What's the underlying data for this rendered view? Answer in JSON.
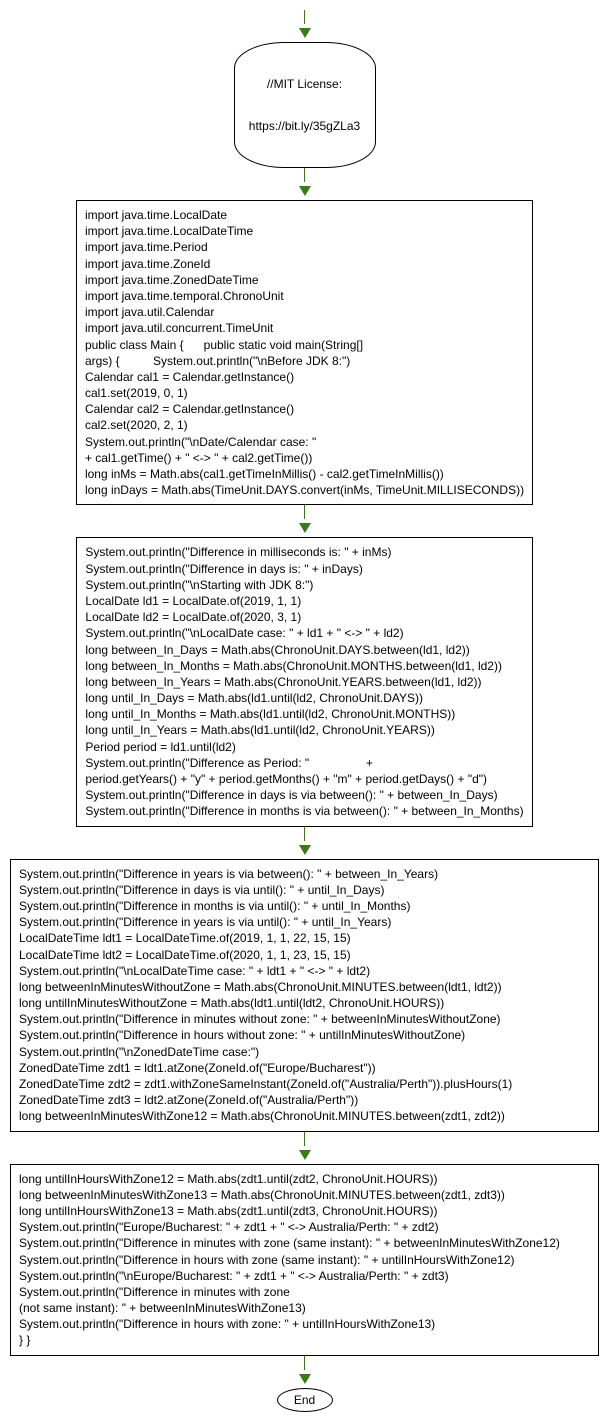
{
  "start": {
    "line1": "//MIT License:",
    "line2": "https://bit.ly/35gZLa3"
  },
  "box1": "import java.time.LocalDate\nimport java.time.LocalDateTime\nimport java.time.Period\nimport java.time.ZoneId\nimport java.time.ZonedDateTime\nimport java.time.temporal.ChronoUnit\nimport java.util.Calendar\nimport java.util.concurrent.TimeUnit\npublic class Main {      public static void main(String[]\nargs) {          System.out.println(\"\\nBefore JDK 8:\")\nCalendar cal1 = Calendar.getInstance()\ncal1.set(2019, 0, 1)\nCalendar cal2 = Calendar.getInstance()\ncal2.set(2020, 2, 1)\nSystem.out.println(\"\\nDate/Calendar case: \"\n+ cal1.getTime() + \" <-> \" + cal2.getTime())\nlong inMs = Math.abs(cal1.getTimeInMillis() - cal2.getTimeInMillis())\nlong inDays = Math.abs(TimeUnit.DAYS.convert(inMs, TimeUnit.MILLISECONDS))",
  "box2": "System.out.println(\"Difference in milliseconds is: \" + inMs)\nSystem.out.println(\"Difference in days is: \" + inDays)\nSystem.out.println(\"\\nStarting with JDK 8:\")\nLocalDate ld1 = LocalDate.of(2019, 1, 1)\nLocalDate ld2 = LocalDate.of(2020, 3, 1)\nSystem.out.println(\"\\nLocalDate case: \" + ld1 + \" <-> \" + ld2)\nlong between_In_Days = Math.abs(ChronoUnit.DAYS.between(ld1, ld2))\nlong between_In_Months = Math.abs(ChronoUnit.MONTHS.between(ld1, ld2))\nlong between_In_Years = Math.abs(ChronoUnit.YEARS.between(ld1, ld2))\nlong until_In_Days = Math.abs(ld1.until(ld2, ChronoUnit.DAYS))\nlong until_In_Months = Math.abs(ld1.until(ld2, ChronoUnit.MONTHS))\nlong until_In_Years = Math.abs(ld1.until(ld2, ChronoUnit.YEARS))\nPeriod period = ld1.until(ld2)\nSystem.out.println(\"Difference as Period: \"                 +\nperiod.getYears() + \"y\" + period.getMonths() + \"m\" + period.getDays() + \"d\")\nSystem.out.println(\"Difference in days is via between(): \" + between_In_Days)\nSystem.out.println(\"Difference in months is via between(): \" + between_In_Months)",
  "box3": "System.out.println(\"Difference in years is via between(): \" + between_In_Years)\nSystem.out.println(\"Difference in days is via until(): \" + until_In_Days)\nSystem.out.println(\"Difference in months is via until(): \" + until_In_Months)\nSystem.out.println(\"Difference in years is via until(): \" + until_In_Years)\nLocalDateTime ldt1 = LocalDateTime.of(2019, 1, 1, 22, 15, 15)\nLocalDateTime ldt2 = LocalDateTime.of(2020, 1, 1, 23, 15, 15)\nSystem.out.println(\"\\nLocalDateTime case: \" + ldt1 + \" <-> \" + ldt2)\nlong betweenInMinutesWithoutZone = Math.abs(ChronoUnit.MINUTES.between(ldt1, ldt2))\nlong untilInMinutesWithoutZone = Math.abs(ldt1.until(ldt2, ChronoUnit.HOURS))\nSystem.out.println(\"Difference in minutes without zone: \" + betweenInMinutesWithoutZone)\nSystem.out.println(\"Difference in hours without zone: \" + untilInMinutesWithoutZone)\nSystem.out.println(\"\\nZonedDateTime case:\")\nZonedDateTime zdt1 = ldt1.atZone(ZoneId.of(\"Europe/Bucharest\"))\nZonedDateTime zdt2 = zdt1.withZoneSameInstant(ZoneId.of(\"Australia/Perth\")).plusHours(1)\nZonedDateTime zdt3 = ldt2.atZone(ZoneId.of(\"Australia/Perth\"))\nlong betweenInMinutesWithZone12 = Math.abs(ChronoUnit.MINUTES.between(zdt1, zdt2))",
  "box4": "long untilInHoursWithZone12 = Math.abs(zdt1.until(zdt2, ChronoUnit.HOURS))\nlong betweenInMinutesWithZone13 = Math.abs(ChronoUnit.MINUTES.between(zdt1, zdt3))\nlong untilInHoursWithZone13 = Math.abs(zdt1.until(zdt3, ChronoUnit.HOURS))\nSystem.out.println(\"Europe/Bucharest: \" + zdt1 + \" <-> Australia/Perth: \" + zdt2)\nSystem.out.println(\"Difference in minutes with zone (same instant): \" + betweenInMinutesWithZone12)\nSystem.out.println(\"Difference in hours with zone (same instant): \" + untilInHoursWithZone12)\nSystem.out.println(\"\\nEurope/Bucharest: \" + zdt1 + \" <-> Australia/Perth: \" + zdt3)\nSystem.out.println(\"Difference in minutes with zone\n(not same instant): \" + betweenInMinutesWithZone13)\nSystem.out.println(\"Difference in hours with zone: \" + untilInHoursWithZone13)\n} }",
  "end": "End"
}
